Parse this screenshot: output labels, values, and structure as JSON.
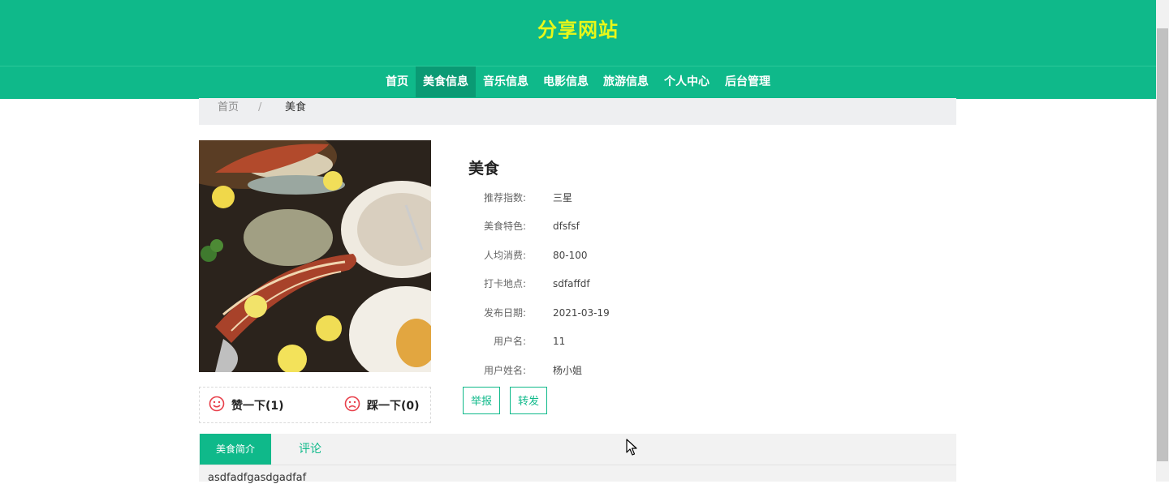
{
  "header": {
    "site_title": "分享网站"
  },
  "nav": {
    "items": [
      {
        "label": "首页"
      },
      {
        "label": "美食信息"
      },
      {
        "label": "音乐信息"
      },
      {
        "label": "电影信息"
      },
      {
        "label": "旅游信息"
      },
      {
        "label": "个人中心"
      },
      {
        "label": "后台管理"
      }
    ],
    "active_index": 1
  },
  "breadcrumb": {
    "home": "首页",
    "separator": "/",
    "current": "美食"
  },
  "detail": {
    "title": "美食",
    "fields": [
      {
        "label": "推荐指数:",
        "value": "三星"
      },
      {
        "label": "美食特色:",
        "value": "dfsfsf"
      },
      {
        "label": "人均消费:",
        "value": "80-100"
      },
      {
        "label": "打卡地点:",
        "value": "sdfaffdf"
      },
      {
        "label": "发布日期:",
        "value": "2021-03-19"
      },
      {
        "label": "用户名:",
        "value": "11"
      },
      {
        "label": "用户姓名:",
        "value": "杨小姐"
      }
    ]
  },
  "votes": {
    "like_label": "赞一下(1)",
    "dislike_label": "踩一下(0)"
  },
  "actions": {
    "report_label": "举报",
    "share_label": "转发"
  },
  "tabs": {
    "intro_label": "美食简介",
    "comment_label": "评论"
  },
  "content": {
    "intro_text": "asdfadfgasdgadfaf"
  },
  "colors": {
    "brand": "#0fb98a",
    "title": "#e9f719",
    "vote_icon": "#e8404b"
  },
  "icons": {
    "like": "smile-icon",
    "dislike": "frown-icon"
  }
}
